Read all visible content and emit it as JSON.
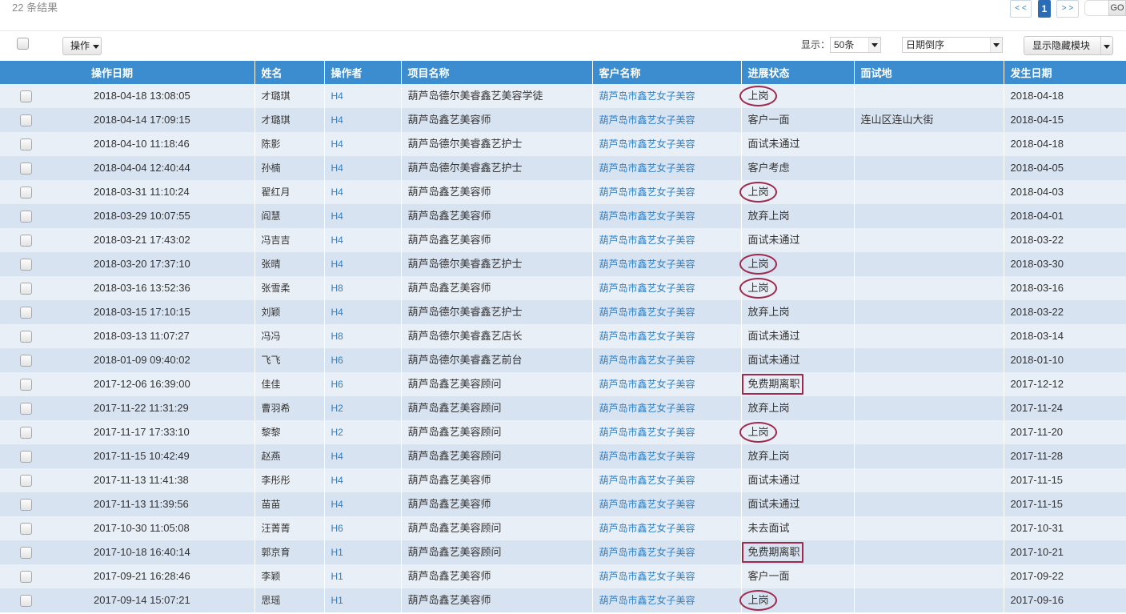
{
  "theme": {
    "header_bg": "#3b8dcf",
    "row_odd": "#e9eff7",
    "row_even": "#d8e3f1",
    "link": "#2f7fc4",
    "annotation": "#9e2a4e",
    "active_page": "#2b6cb7"
  },
  "summary": {
    "result_count": "22 条结果"
  },
  "pagination": {
    "prev_label": "< <",
    "current_page": "1",
    "next_label": "> >",
    "jump_value": "",
    "go_label": "GO"
  },
  "toolbar": {
    "actions_label": "操作",
    "show_label": "显示：",
    "page_size": "50条",
    "sort_order": "日期倒序",
    "toggle_modules_label": "显示隐藏模块"
  },
  "table": {
    "columns": [
      "操作日期",
      "姓名",
      "操作者",
      "项目名称",
      "客户名称",
      "进展状态",
      "面试地",
      "发生日期"
    ],
    "rows": [
      {
        "op_date": "2018-04-18 13:08:05",
        "name": "才璐琪",
        "operator": "H4",
        "project": "葫芦岛德尔美睿鑫艺美容学徒",
        "client": "葫芦岛市鑫艺女子美容",
        "status": "上岗",
        "interview_place": "",
        "event_date": "2018-04-18",
        "mark": "ellipse"
      },
      {
        "op_date": "2018-04-14 17:09:15",
        "name": "才璐琪",
        "operator": "H4",
        "project": "葫芦岛鑫艺美容师",
        "client": "葫芦岛市鑫艺女子美容",
        "status": "客户一面",
        "interview_place": "连山区连山大街",
        "event_date": "2018-04-15"
      },
      {
        "op_date": "2018-04-10 11:18:46",
        "name": "陈影",
        "operator": "H4",
        "project": "葫芦岛德尔美睿鑫艺护士",
        "client": "葫芦岛市鑫艺女子美容",
        "status": "面试未通过",
        "interview_place": "",
        "event_date": "2018-04-18"
      },
      {
        "op_date": "2018-04-04 12:40:44",
        "name": "孙楠",
        "operator": "H4",
        "project": "葫芦岛德尔美睿鑫艺护士",
        "client": "葫芦岛市鑫艺女子美容",
        "status": "客户考虑",
        "interview_place": "",
        "event_date": "2018-04-05"
      },
      {
        "op_date": "2018-03-31 11:10:24",
        "name": "翟红月",
        "operator": "H4",
        "project": "葫芦岛鑫艺美容师",
        "client": "葫芦岛市鑫艺女子美容",
        "status": "上岗",
        "interview_place": "",
        "event_date": "2018-04-03",
        "mark": "ellipse"
      },
      {
        "op_date": "2018-03-29 10:07:55",
        "name": "阎慧",
        "operator": "H4",
        "project": "葫芦岛鑫艺美容师",
        "client": "葫芦岛市鑫艺女子美容",
        "status": "放弃上岗",
        "interview_place": "",
        "event_date": "2018-04-01"
      },
      {
        "op_date": "2018-03-21 17:43:02",
        "name": "冯吉吉",
        "operator": "H4",
        "project": "葫芦岛鑫艺美容师",
        "client": "葫芦岛市鑫艺女子美容",
        "status": "面试未通过",
        "interview_place": "",
        "event_date": "2018-03-22"
      },
      {
        "op_date": "2018-03-20 17:37:10",
        "name": "张晴",
        "operator": "H4",
        "project": "葫芦岛德尔美睿鑫艺护士",
        "client": "葫芦岛市鑫艺女子美容",
        "status": "上岗",
        "interview_place": "",
        "event_date": "2018-03-30",
        "mark": "ellipse"
      },
      {
        "op_date": "2018-03-16 13:52:36",
        "name": "张雪柔",
        "operator": "H8",
        "project": "葫芦岛鑫艺美容师",
        "client": "葫芦岛市鑫艺女子美容",
        "status": "上岗",
        "interview_place": "",
        "event_date": "2018-03-16",
        "mark": "ellipse"
      },
      {
        "op_date": "2018-03-15 17:10:15",
        "name": "刘颖",
        "operator": "H4",
        "project": "葫芦岛德尔美睿鑫艺护士",
        "client": "葫芦岛市鑫艺女子美容",
        "status": "放弃上岗",
        "interview_place": "",
        "event_date": "2018-03-22"
      },
      {
        "op_date": "2018-03-13 11:07:27",
        "name": "冯冯",
        "operator": "H8",
        "project": "葫芦岛德尔美睿鑫艺店长",
        "client": "葫芦岛市鑫艺女子美容",
        "status": "面试未通过",
        "interview_place": "",
        "event_date": "2018-03-14"
      },
      {
        "op_date": "2018-01-09 09:40:02",
        "name": "飞飞",
        "operator": "H6",
        "project": "葫芦岛德尔美睿鑫艺前台",
        "client": "葫芦岛市鑫艺女子美容",
        "status": "面试未通过",
        "interview_place": "",
        "event_date": "2018-01-10"
      },
      {
        "op_date": "2017-12-06 16:39:00",
        "name": "佳佳",
        "operator": "H6",
        "project": "葫芦岛鑫艺美容顾问",
        "client": "葫芦岛市鑫艺女子美容",
        "status": "免费期离职",
        "interview_place": "",
        "event_date": "2017-12-12",
        "mark": "rect"
      },
      {
        "op_date": "2017-11-22 11:31:29",
        "name": "曹羽希",
        "operator": "H2",
        "project": "葫芦岛鑫艺美容顾问",
        "client": "葫芦岛市鑫艺女子美容",
        "status": "放弃上岗",
        "interview_place": "",
        "event_date": "2017-11-24"
      },
      {
        "op_date": "2017-11-17 17:33:10",
        "name": "黎黎",
        "operator": "H2",
        "project": "葫芦岛鑫艺美容顾问",
        "client": "葫芦岛市鑫艺女子美容",
        "status": "上岗",
        "interview_place": "",
        "event_date": "2017-11-20",
        "mark": "ellipse"
      },
      {
        "op_date": "2017-11-15 10:42:49",
        "name": "赵燕",
        "operator": "H4",
        "project": "葫芦岛鑫艺美容顾问",
        "client": "葫芦岛市鑫艺女子美容",
        "status": "放弃上岗",
        "interview_place": "",
        "event_date": "2017-11-28"
      },
      {
        "op_date": "2017-11-13 11:41:38",
        "name": "李彤彤",
        "operator": "H4",
        "project": "葫芦岛鑫艺美容师",
        "client": "葫芦岛市鑫艺女子美容",
        "status": "面试未通过",
        "interview_place": "",
        "event_date": "2017-11-15"
      },
      {
        "op_date": "2017-11-13 11:39:56",
        "name": "苗苗",
        "operator": "H4",
        "project": "葫芦岛鑫艺美容师",
        "client": "葫芦岛市鑫艺女子美容",
        "status": "面试未通过",
        "interview_place": "",
        "event_date": "2017-11-15"
      },
      {
        "op_date": "2017-10-30 11:05:08",
        "name": "汪菁菁",
        "operator": "H6",
        "project": "葫芦岛鑫艺美容顾问",
        "client": "葫芦岛市鑫艺女子美容",
        "status": "未去面试",
        "interview_place": "",
        "event_date": "2017-10-31"
      },
      {
        "op_date": "2017-10-18 16:40:14",
        "name": "郭京育",
        "operator": "H1",
        "project": "葫芦岛鑫艺美容顾问",
        "client": "葫芦岛市鑫艺女子美容",
        "status": "免费期离职",
        "interview_place": "",
        "event_date": "2017-10-21",
        "mark": "rect"
      },
      {
        "op_date": "2017-09-21 16:28:46",
        "name": "李颖",
        "operator": "H1",
        "project": "葫芦岛鑫艺美容师",
        "client": "葫芦岛市鑫艺女子美容",
        "status": "客户一面",
        "interview_place": "",
        "event_date": "2017-09-22"
      },
      {
        "op_date": "2017-09-14 15:07:21",
        "name": "思瑶",
        "operator": "H1",
        "project": "葫芦岛鑫艺美容师",
        "client": "葫芦岛市鑫艺女子美容",
        "status": "上岗",
        "interview_place": "",
        "event_date": "2017-09-16",
        "mark": "ellipse"
      }
    ]
  }
}
